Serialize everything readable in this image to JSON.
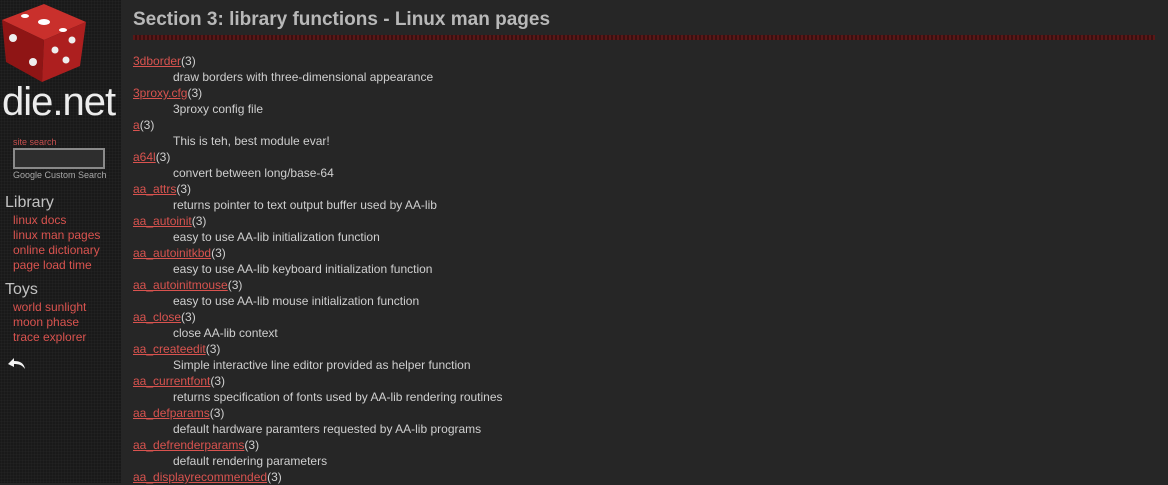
{
  "site": {
    "logo_text": "die.net",
    "search_label": "site search",
    "search_value": "",
    "search_powered": "Google Custom Search"
  },
  "nav": {
    "library_heading": "Library",
    "library_links": [
      "linux docs",
      "linux man pages",
      "online dictionary",
      "page load time"
    ],
    "toys_heading": "Toys",
    "toys_links": [
      "world sunlight",
      "moon phase",
      "trace explorer"
    ]
  },
  "page": {
    "title": "Section 3: library functions - Linux man pages"
  },
  "entries": [
    {
      "name": "3dborder",
      "section": "(3)",
      "desc": "draw borders with three-dimensional appearance"
    },
    {
      "name": "3proxy.cfg",
      "section": "(3)",
      "desc": "3proxy config file"
    },
    {
      "name": "a",
      "section": "(3)",
      "desc": "This is teh, best module evar!"
    },
    {
      "name": "a64l",
      "section": "(3)",
      "desc": "convert between long/base-64"
    },
    {
      "name": "aa_attrs",
      "section": "(3)",
      "desc": "returns pointer to text output buffer used by AA-lib"
    },
    {
      "name": "aa_autoinit",
      "section": "(3)",
      "desc": "easy to use AA-lib initialization function"
    },
    {
      "name": "aa_autoinitkbd",
      "section": "(3)",
      "desc": "easy to use AA-lib keyboard initialization function"
    },
    {
      "name": "aa_autoinitmouse",
      "section": "(3)",
      "desc": "easy to use AA-lib mouse initialization function"
    },
    {
      "name": "aa_close",
      "section": "(3)",
      "desc": "close AA-lib context"
    },
    {
      "name": "aa_createedit",
      "section": "(3)",
      "desc": "Simple interactive line editor provided as helper function"
    },
    {
      "name": "aa_currentfont",
      "section": "(3)",
      "desc": "returns specification of fonts used by AA-lib rendering routines"
    },
    {
      "name": "aa_defparams",
      "section": "(3)",
      "desc": "default hardware paramters requested by AA-lib programs"
    },
    {
      "name": "aa_defrenderparams",
      "section": "(3)",
      "desc": "default rendering parameters"
    },
    {
      "name": "aa_displayrecommended",
      "section": "(3)",
      "desc": ""
    }
  ]
}
